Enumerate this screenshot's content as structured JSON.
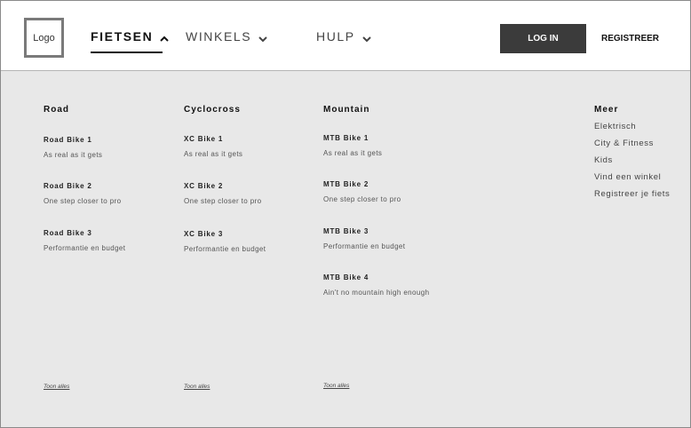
{
  "header": {
    "logo_text": "Logo",
    "nav": [
      {
        "label": "FIETSEN",
        "icon": "chevron-up-icon"
      },
      {
        "label": "WINKELS",
        "icon": "chevron-down-icon"
      },
      {
        "label": "HULP",
        "icon": "chevron-down-icon"
      }
    ],
    "login_label": "LOG IN",
    "register_label": "REGISTREER"
  },
  "menu": {
    "columns": [
      {
        "title": "Road",
        "items": [
          {
            "name": "Road Bike 1",
            "desc": "As real as it gets"
          },
          {
            "name": "Road Bike 2",
            "desc": "One step closer to pro"
          },
          {
            "name": "Road Bike 3",
            "desc": "Performantie en budget"
          }
        ],
        "show_all": "Toon alles"
      },
      {
        "title": "Cyclocross",
        "items": [
          {
            "name": "XC Bike 1",
            "desc": "As real as it gets"
          },
          {
            "name": "XC Bike 2",
            "desc": "One step closer to pro"
          },
          {
            "name": "XC Bike 3",
            "desc": "Performantie en budget"
          }
        ],
        "show_all": "Toon alles"
      },
      {
        "title": "Mountain",
        "items": [
          {
            "name": "MTB Bike 1",
            "desc": "As real as it gets"
          },
          {
            "name": "MTB Bike 2",
            "desc": "One step closer to pro"
          },
          {
            "name": "MTB Bike 3",
            "desc": "Performantie en budget"
          },
          {
            "name": "MTB Bike 4",
            "desc": "Ain't no mountain high enough"
          }
        ],
        "show_all": "Toon alles"
      }
    ],
    "more": {
      "title": "Meer",
      "links": [
        "Elektrisch",
        "City & Fitness",
        "Kids",
        "Vind een winkel",
        "Registreer je fiets"
      ]
    }
  }
}
